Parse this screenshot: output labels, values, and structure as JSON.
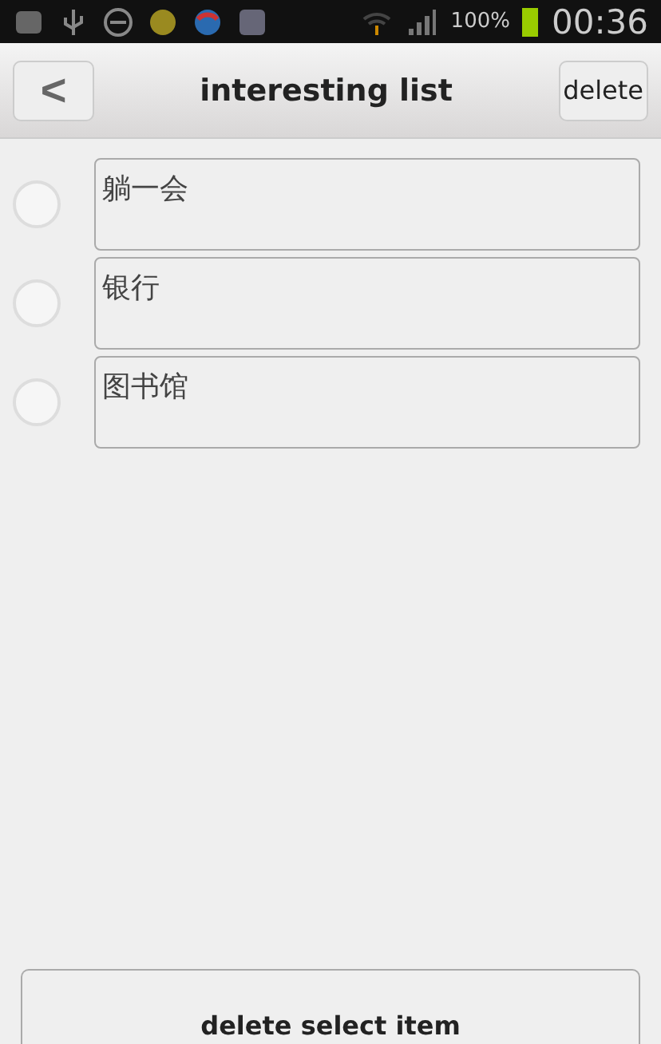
{
  "status_bar": {
    "battery": "100%",
    "time": "00:36"
  },
  "header": {
    "back": "<",
    "title": "interesting list",
    "action": "delete"
  },
  "items": [
    {
      "text": "躺一会",
      "selected": false
    },
    {
      "text": "银行",
      "selected": false
    },
    {
      "text": "图书馆",
      "selected": false
    }
  ],
  "footer": {
    "button": "delete select item"
  }
}
